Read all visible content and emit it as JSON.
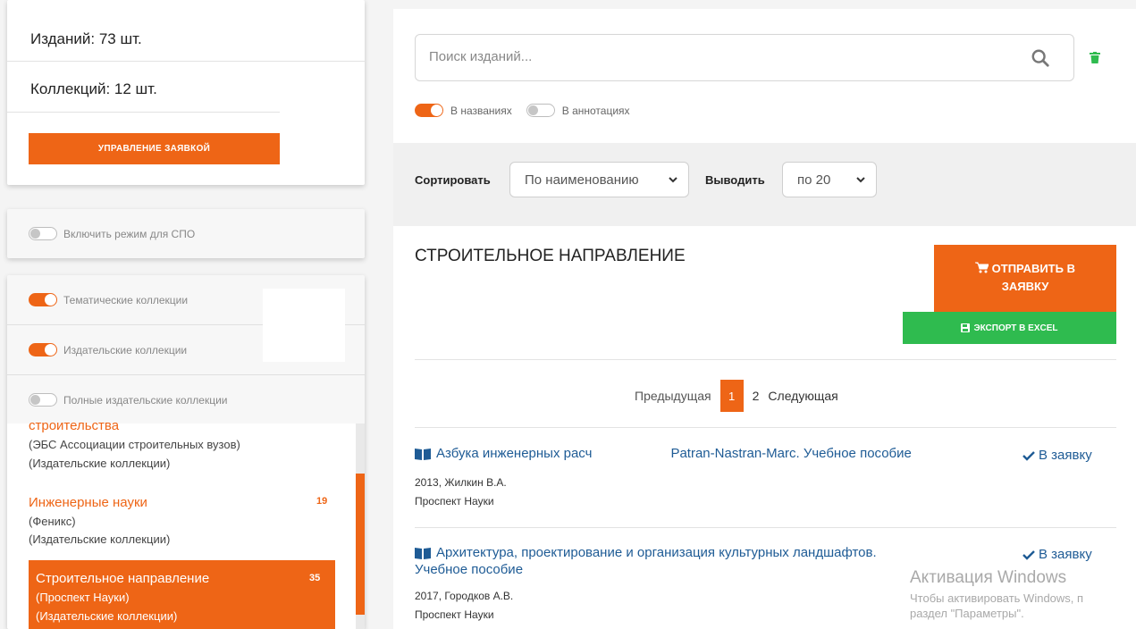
{
  "stats": {
    "editions": "Изданий: 73 шт.",
    "collections": "Коллекций: 12 шт.",
    "manage_button": "УПРАВЛЕНИЕ ЗАЯВКОЙ"
  },
  "spo": {
    "label": "Включить режим для СПО",
    "enabled": false
  },
  "collection_filters": [
    {
      "label": "Тематические коллекции",
      "enabled": true
    },
    {
      "label": "Издательские коллекции",
      "enabled": true
    },
    {
      "label": "Полные издательские коллекции",
      "enabled": false
    }
  ],
  "collection_list": [
    {
      "title": "строительства",
      "sub1": "(ЭБС Ассоциации строительных вузов)",
      "sub2": "(Издательские коллекции)",
      "count": ""
    },
    {
      "title": "Инженерные науки",
      "sub1": "(Феникс)",
      "sub2": "(Издательские коллекции)",
      "count": "19"
    },
    {
      "title": "Строительное направление",
      "sub1": "(Проспект Науки)",
      "sub2": "(Издательские коллекции)",
      "count": "35",
      "active": true
    }
  ],
  "search": {
    "placeholder": "Поиск изданий...",
    "value": "",
    "in_titles_label": "В названиях",
    "in_titles": true,
    "in_annotations_label": "В аннотациях",
    "in_annotations": false
  },
  "sort": {
    "sort_label": "Сортировать",
    "sort_value": "По наименованию",
    "show_label": "Выводить",
    "show_value": "по 20"
  },
  "section": {
    "title": "СТРОИТЕЛЬНОЕ НАПРАВЛЕНИЕ",
    "send_button_line1": "ОТПРАВИТЬ В",
    "send_button_line2": "ЗАЯВКУ",
    "excel_button": "ЭКСПОРТ В EXCEL"
  },
  "pagination": {
    "prev": "Предыдущая",
    "pages": [
      "1",
      "2"
    ],
    "current": "1",
    "next": "Следующая"
  },
  "books": [
    {
      "title_left": "Азбука инженерных расч",
      "title_right": "Patran-Nastran-Marc. Учебное пособие",
      "meta1": "2013, Жилкин В.А.",
      "meta2": "Проспект Науки",
      "add": "В заявку"
    },
    {
      "title_line1": "Архитектура, проектирование и организация культурных ландшафтов.",
      "title_line2": "Учебное пособие",
      "meta1": "2017, Городков А.В.",
      "meta2": "Проспект Науки",
      "add": "В заявку"
    }
  ],
  "watermark": {
    "title": "Активация Windows",
    "line1": "Чтобы активировать Windows, п",
    "line2": "раздел \"Параметры\"."
  },
  "colors": {
    "accent": "#ee6516",
    "green": "#2fbb4f",
    "link": "#1e5b95"
  }
}
